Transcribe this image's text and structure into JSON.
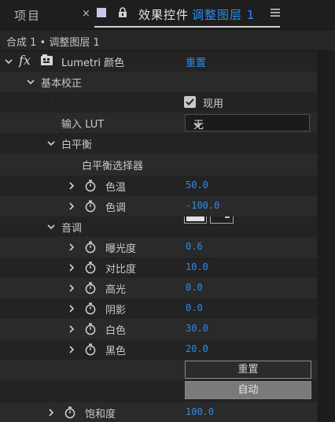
{
  "tabs": {
    "project": "项目",
    "close_glyph": "×",
    "effects_title": "效果控件",
    "layer_name": "调整图层 1",
    "menu_glyph": "≡"
  },
  "breadcrumb": "合成 1 • 调整图层 1",
  "effect": {
    "fx_label": "fx",
    "name": "Lumetri 颜色",
    "reset": "重置"
  },
  "basic": {
    "section": "基本校正",
    "enable_label": "现用",
    "input_lut_label": "输入 LUT",
    "input_lut_value": "无",
    "white_balance": {
      "section": "白平衡",
      "selector_label": "白平衡选择器",
      "temperature_label": "色温",
      "temperature_value": "50.0",
      "tint_label": "色调",
      "tint_value": "-100.0"
    },
    "tone": {
      "section": "音调",
      "exposure_label": "曝光度",
      "exposure_value": "0.6",
      "contrast_label": "对比度",
      "contrast_value": "10.0",
      "highlights_label": "高光",
      "highlights_value": "0.0",
      "shadows_label": "阴影",
      "shadows_value": "0.0",
      "whites_label": "白色",
      "whites_value": "30.0",
      "blacks_label": "黑色",
      "blacks_value": "20.0",
      "reset_button": "重置",
      "auto_button": "自动"
    },
    "saturation_label": "饱和度",
    "saturation_value": "100.0"
  },
  "colors": {
    "accent": "#2d8ceb",
    "panel_bg": "#232323",
    "row_alt": "#2a2a2a"
  }
}
